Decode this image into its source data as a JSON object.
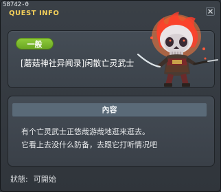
{
  "window": {
    "id": "58742-0",
    "title": "QUEST INFO"
  },
  "quest": {
    "category": "一般",
    "name": "[蘑菇神社异闻录]闲散亡灵武士"
  },
  "content": {
    "header": "內容",
    "lines": [
      "有个亡灵武士正悠哉游哉地逛来逛去。",
      "它看上去没什么防备，去跟它打听情况吧"
    ]
  },
  "status": {
    "label": "狀態:",
    "value": "可開始"
  },
  "icons": {
    "close": "close-icon",
    "monster": "undead-samurai-icon"
  }
}
